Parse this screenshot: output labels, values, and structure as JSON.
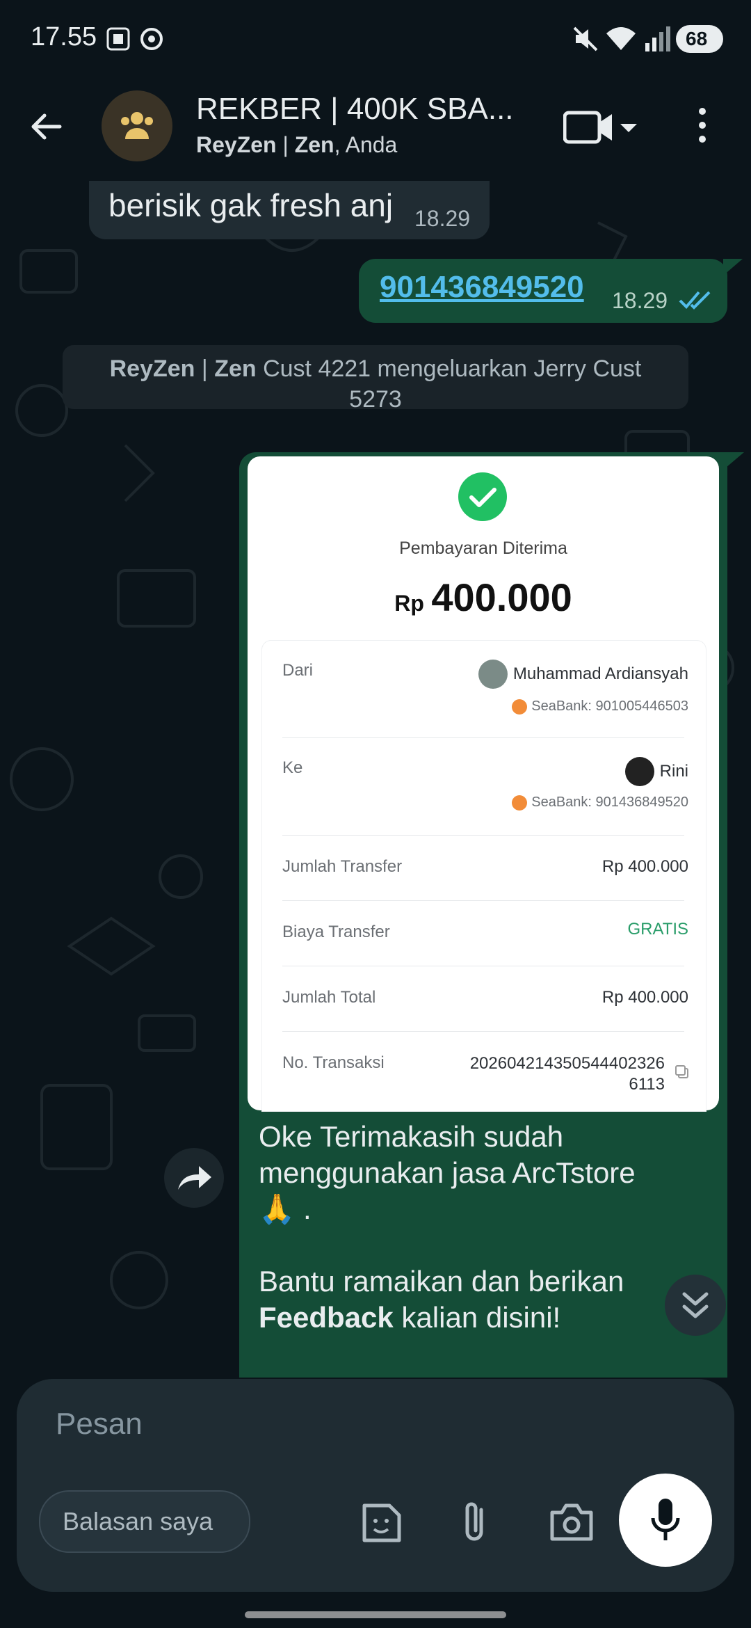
{
  "status_bar": {
    "time": "17.55",
    "battery": "68"
  },
  "header": {
    "title": "REKBER | 400K SBA...",
    "subtitle_bold1": "ReyZen",
    "subtitle_sep": " | ",
    "subtitle_bold2": "Zen",
    "subtitle_rest": ", Anda"
  },
  "messages": {
    "m1": {
      "text": "berisik gak fresh anj",
      "time": "18.29"
    },
    "m2": {
      "text": "901436849520",
      "time": "18.29"
    },
    "system": {
      "bold1": "ReyZen",
      "sep": " | ",
      "bold2": "Zen",
      "rest": " Cust 4221 mengeluarkan Jerry Cust 5273"
    },
    "m3": {
      "line1": "Oke Terimakasih sudah",
      "line2": "menggunakan jasa ArcTstore",
      "line3": "🙏 .",
      "line4": "Bantu ramaikan dan berikan",
      "line5_bold": "Feedback",
      "line5_rest": " kalian disini!"
    }
  },
  "receipt": {
    "status": "Pembayaran Diterima",
    "currency": "Rp",
    "amount": "400.000",
    "from_label": "Dari",
    "from_name": "Muhammad Ardiansyah",
    "from_bank": "SeaBank: 901005446503",
    "to_label": "Ke",
    "to_name": "Rini",
    "to_bank": "SeaBank: 901436849520",
    "rows": [
      {
        "label": "Jumlah Transfer",
        "value": "Rp 400.000"
      },
      {
        "label": "Biaya Transfer",
        "value": "GRATIS"
      },
      {
        "label": "Jumlah Total",
        "value": "Rp 400.000"
      }
    ],
    "trx_label": "No. Transaksi",
    "trx_line1": "202604214350544402326",
    "trx_line2": "6113"
  },
  "composer": {
    "placeholder": "Pesan",
    "quick_reply": "Balasan saya"
  },
  "colors": {
    "accent_green": "#21c063",
    "free_green": "#2a9d6a",
    "link_blue": "#53bdeb"
  }
}
